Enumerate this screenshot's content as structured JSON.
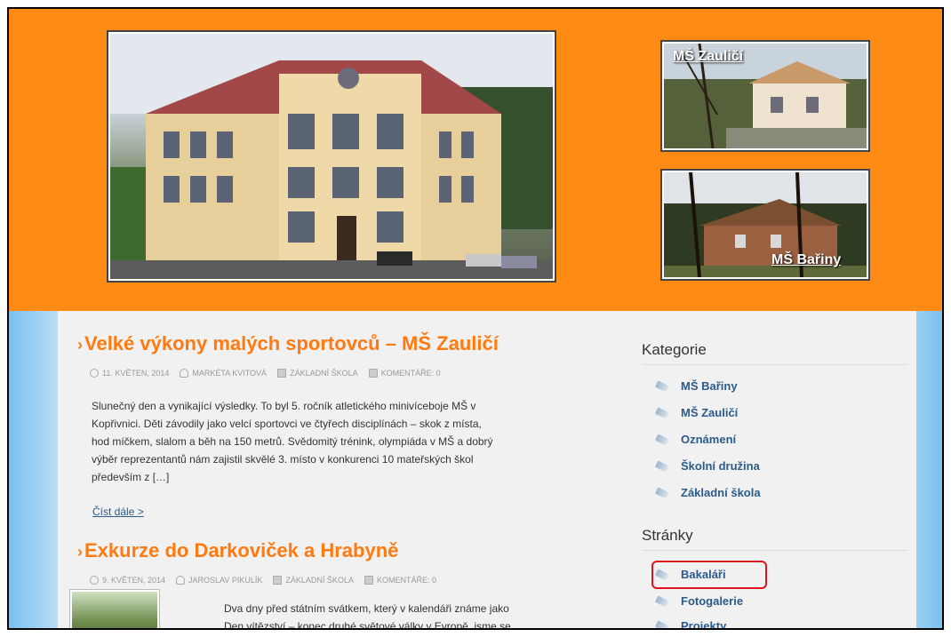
{
  "header": {
    "thumb1_caption": "MŠ Zauličí",
    "thumb2_caption": "MŠ Bařiny"
  },
  "posts": [
    {
      "title": "Velké výkony malých sportovců – MŠ Zauličí",
      "date": "11. KVĚTEN, 2014",
      "author": "MARKÉTA KVITOVÁ",
      "category": "ZÁKLADNÍ ŠKOLA",
      "comments": "KOMENTÁŘE: 0",
      "excerpt_lines": [
        "Slunečný den a vynikající výsledky. To byl 5. ročník atletického minivíceboje MŠ v",
        "Kopřivnici. Děti závodily jako velcí sportovci ve čtyřech disciplínách – skok z místa,",
        "hod míčkem, slalom a běh na 150 metrů. Svědomitý trénink, olympiáda v MŠ a dobrý",
        "výběr reprezentantů nám zajistil skvělé 3. místo v konkurenci 10 mateřských škol",
        "především z […]"
      ],
      "read_more": "Číst dále >"
    },
    {
      "title": "Exkurze do Darkoviček a Hrabyně",
      "date": "9. KVĚTEN, 2014",
      "author": "JAROSLAV PIKULÍK",
      "category": "ZÁKLADNÍ ŠKOLA",
      "comments": "KOMENTÁŘE: 0",
      "excerpt_lines": [
        "Dva dny před státním svátkem, který v kalendáři známe jako",
        "Den vítězství – konec druhé světové války v Evropě, jsme se"
      ]
    }
  ],
  "sidebar": {
    "categories_heading": "Kategorie",
    "categories": [
      "MŠ Bařiny",
      "MŠ Zauličí",
      "Oznámení",
      "Školní družina",
      "Základní škola"
    ],
    "pages_heading": "Stránky",
    "pages": [
      "Bakaláři",
      "Fotogalerie",
      "Projekty"
    ]
  },
  "colors": {
    "header_orange": "#ff8a14",
    "title_orange": "#ff7a10",
    "link_blue": "#2a5b8a",
    "highlight_red": "#e0141e"
  }
}
